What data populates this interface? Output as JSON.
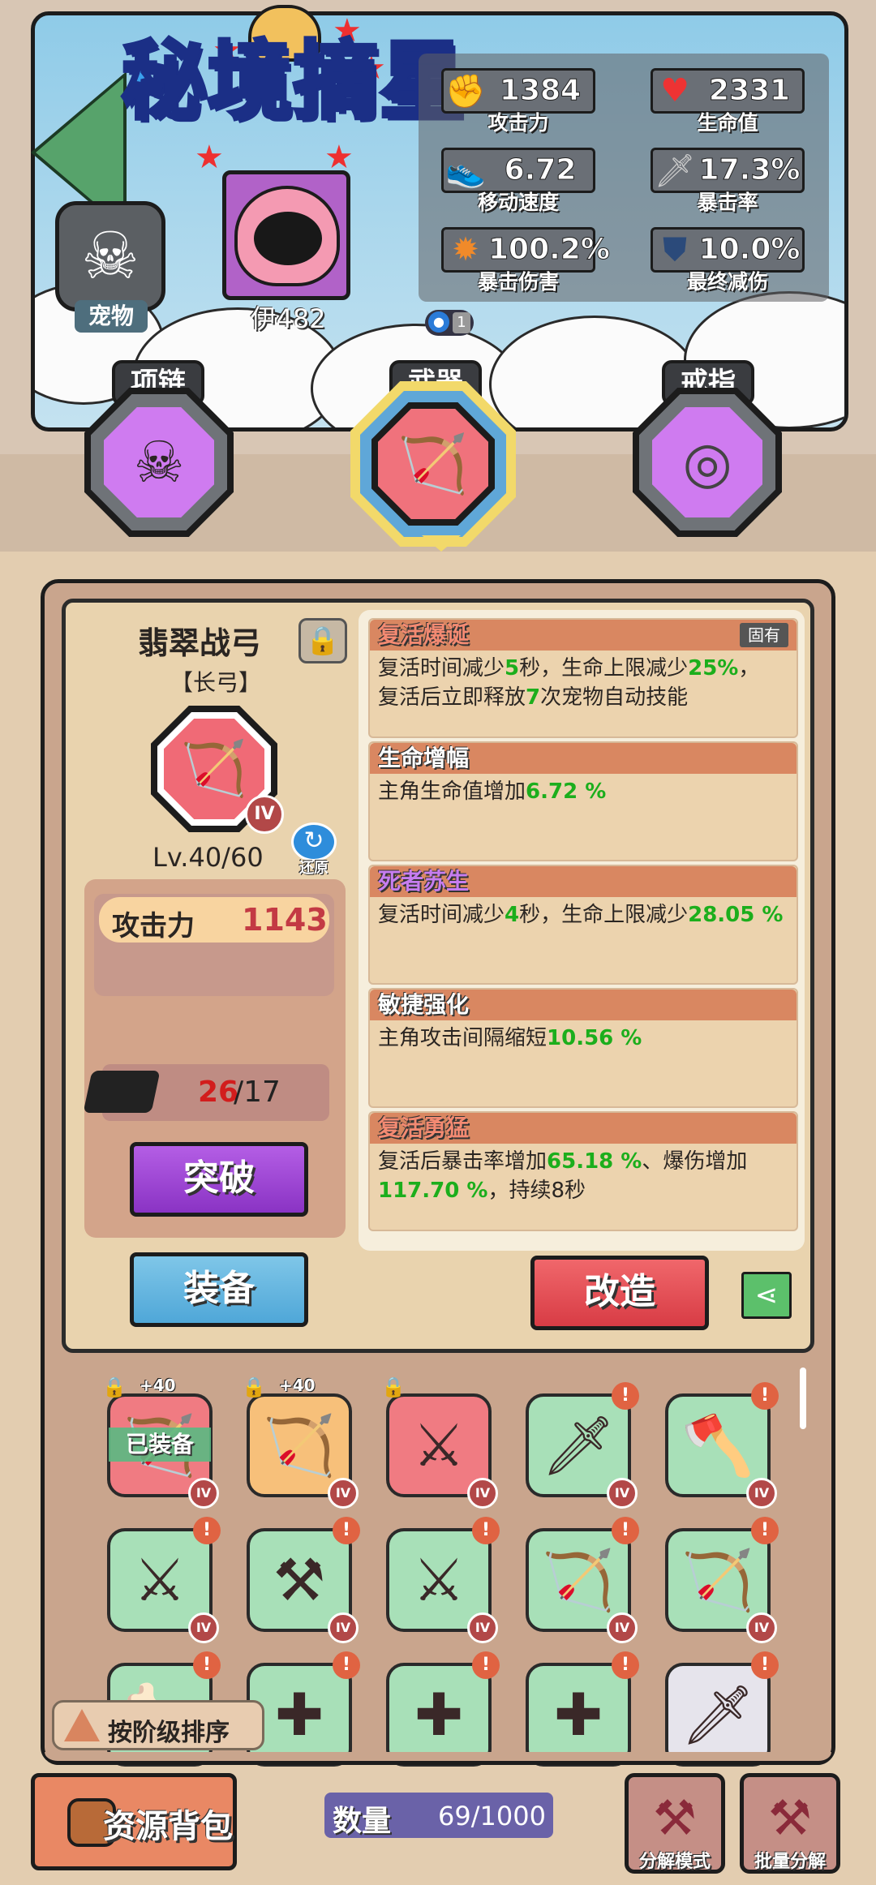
{
  "header": {
    "title": "秘境摘星",
    "pet": {
      "label": "宠物"
    },
    "player": {
      "name": "伊482"
    },
    "drop_count": "1"
  },
  "stats": [
    {
      "icon": "fist-icon",
      "value": "1384",
      "label": "攻击力"
    },
    {
      "icon": "heart-icon",
      "value": "2331",
      "label": "生命值"
    },
    {
      "icon": "shoe-icon",
      "value": "6.72",
      "label": "移动速度"
    },
    {
      "icon": "sword-icon",
      "value": "17.3%",
      "label": "暴击率"
    },
    {
      "icon": "explosion-icon",
      "value": "100.2%",
      "label": "暴击伤害"
    },
    {
      "icon": "shield-icon",
      "value": "10.0%",
      "label": "最终减伤"
    }
  ],
  "slots": {
    "necklace": "项链",
    "weapon": "武器",
    "ring": "戒指"
  },
  "item": {
    "name": "翡翠战弓",
    "type": "【长弓】",
    "rank": "IV",
    "level": "Lv.40/60",
    "restore_label": "还原",
    "attack_label": "攻击力",
    "attack_value": "1143",
    "material_have": "26",
    "material_need": "/17",
    "breakthrough_label": "突破",
    "equip_label": "装备",
    "reforge_label": "改造"
  },
  "effects": [
    {
      "title": "复活爆诞",
      "tag": "固有",
      "line1_a": "复活时间减少",
      "line1_b": "5",
      "line1_c": "秒，生命上限减少",
      "line1_d": "25%",
      "line1_e": "，",
      "line2_a": "复活后立即释放",
      "line2_b": "7",
      "line2_c": "次宠物自动技能"
    },
    {
      "title": "生命增幅",
      "line1_a": "主角生命值增加",
      "line1_b": "6.72 %"
    },
    {
      "title": "死者苏生",
      "line1_a": "复活时间减少",
      "line1_b": "4",
      "line1_c": "秒，生命上限减少",
      "line1_d": "28.05 %"
    },
    {
      "title": "敏捷强化",
      "line1_a": "主角攻击间隔缩短",
      "line1_b": "10.56 %"
    },
    {
      "title": "复活勇猛",
      "line1_a": "复活后暴击率增加",
      "line1_b": "65.18 %",
      "line1_c": "、爆伤增加",
      "line2_a": "117.70 %",
      "line2_b": "，持续8秒"
    }
  ],
  "inventory": {
    "equipped_label": "已装备",
    "plus_label": "+40",
    "rank_label": "IV",
    "items": [
      {
        "icon": "bow-icon",
        "color": "red"
      },
      {
        "icon": "bow-icon",
        "color": "gold"
      },
      {
        "icon": "dual-blade-icon",
        "color": "red"
      },
      {
        "icon": "greatsword-icon",
        "color": "green"
      },
      {
        "icon": "axe-icon",
        "color": "green"
      },
      {
        "icon": "dual-sword-icon",
        "color": "green"
      },
      {
        "icon": "dual-axe-icon",
        "color": "green"
      },
      {
        "icon": "scythe-icon",
        "color": "green"
      },
      {
        "icon": "bow-icon",
        "color": "green"
      },
      {
        "icon": "bow-icon",
        "color": "green"
      },
      {
        "icon": "bone-bow-icon",
        "color": "green"
      },
      {
        "icon": "crossbow-icon",
        "color": "green"
      },
      {
        "icon": "crossbow-icon",
        "color": "green"
      },
      {
        "icon": "crossbow-icon",
        "color": "green"
      },
      {
        "icon": "sword-icon",
        "color": "white"
      }
    ],
    "sort_label": "按阶级排序"
  },
  "footer": {
    "resource_bag": "资源背包",
    "count_label": "数量",
    "count_value": "69/1000",
    "disassemble_mode": "分解模式",
    "batch_disassemble": "批量分解"
  }
}
